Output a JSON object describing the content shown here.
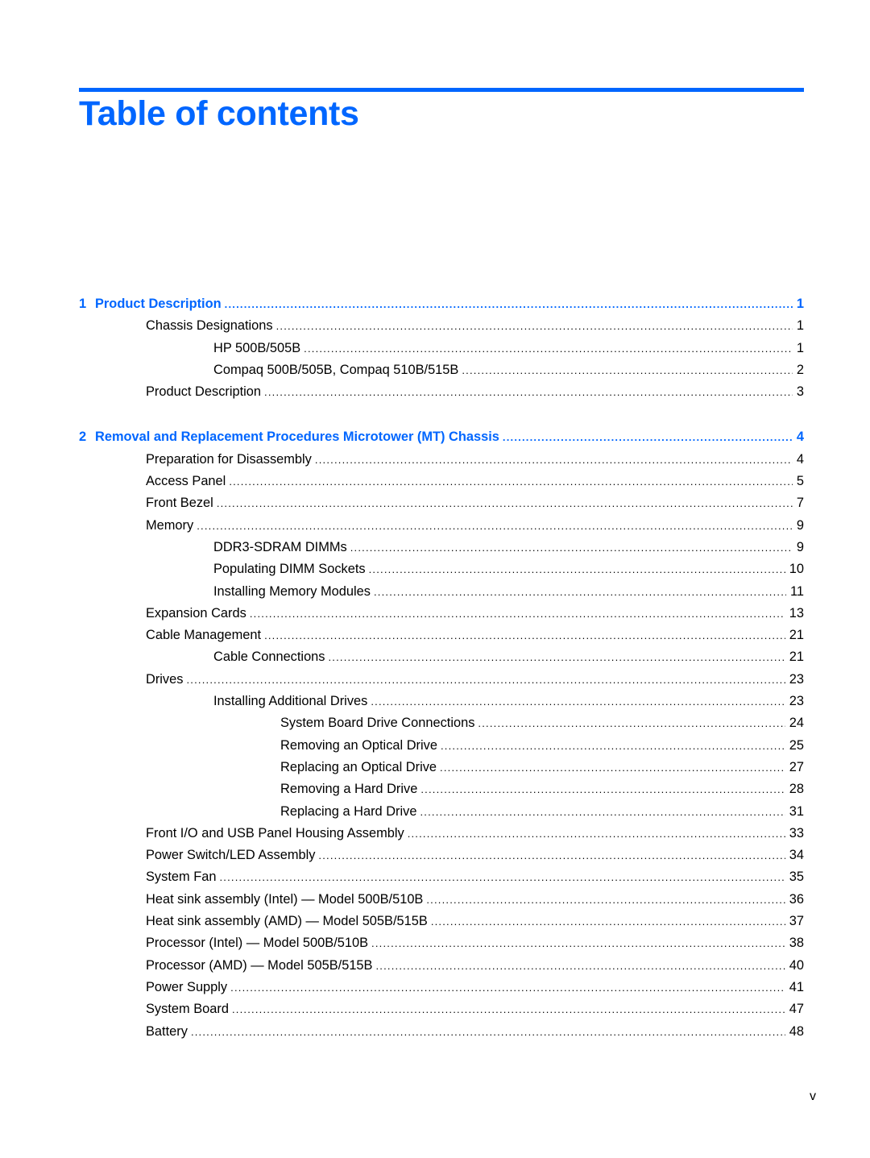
{
  "title": "Table of contents",
  "colors": {
    "accent": "#0066ff",
    "text": "#000000"
  },
  "chapters": [
    {
      "number": "1",
      "title": "Product Description",
      "page": "1",
      "entries": [
        {
          "level": 1,
          "title": "Chassis Designations",
          "page": "1"
        },
        {
          "level": 2,
          "title": "HP 500B/505B",
          "page": "1"
        },
        {
          "level": 2,
          "title": "Compaq 500B/505B, Compaq 510B/515B",
          "page": "2"
        },
        {
          "level": 1,
          "title": "Product Description",
          "page": "3"
        }
      ]
    },
    {
      "number": "2",
      "title": "Removal and Replacement Procedures Microtower (MT) Chassis",
      "page": "4",
      "entries": [
        {
          "level": 1,
          "title": "Preparation for Disassembly",
          "page": "4"
        },
        {
          "level": 1,
          "title": "Access Panel",
          "page": "5"
        },
        {
          "level": 1,
          "title": "Front Bezel",
          "page": "7"
        },
        {
          "level": 1,
          "title": "Memory",
          "page": "9"
        },
        {
          "level": 2,
          "title": "DDR3-SDRAM DIMMs",
          "page": "9"
        },
        {
          "level": 2,
          "title": "Populating DIMM Sockets",
          "page": "10"
        },
        {
          "level": 2,
          "title": "Installing Memory Modules",
          "page": "11"
        },
        {
          "level": 1,
          "title": "Expansion Cards",
          "page": "13"
        },
        {
          "level": 1,
          "title": "Cable Management",
          "page": "21"
        },
        {
          "level": 2,
          "title": "Cable Connections",
          "page": "21"
        },
        {
          "level": 1,
          "title": "Drives",
          "page": "23"
        },
        {
          "level": 2,
          "title": "Installing Additional Drives",
          "page": "23"
        },
        {
          "level": 3,
          "title": "System Board Drive Connections",
          "page": "24"
        },
        {
          "level": 3,
          "title": "Removing an Optical Drive",
          "page": "25"
        },
        {
          "level": 3,
          "title": "Replacing an Optical Drive",
          "page": "27"
        },
        {
          "level": 3,
          "title": "Removing a Hard Drive",
          "page": "28"
        },
        {
          "level": 3,
          "title": "Replacing a Hard Drive",
          "page": "31"
        },
        {
          "level": 1,
          "title": "Front I/O and USB Panel Housing Assembly",
          "page": "33"
        },
        {
          "level": 1,
          "title": "Power Switch/LED Assembly",
          "page": "34"
        },
        {
          "level": 1,
          "title": "System Fan",
          "page": "35"
        },
        {
          "level": 1,
          "title": "Heat sink assembly (Intel) — Model 500B/510B",
          "page": "36"
        },
        {
          "level": 1,
          "title": "Heat sink assembly (AMD) — Model 505B/515B",
          "page": "37"
        },
        {
          "level": 1,
          "title": "Processor (Intel) — Model 500B/510B",
          "page": "38"
        },
        {
          "level": 1,
          "title": "Processor (AMD) — Model 505B/515B",
          "page": "40"
        },
        {
          "level": 1,
          "title": "Power Supply",
          "page": "41"
        },
        {
          "level": 1,
          "title": "System Board",
          "page": "47"
        },
        {
          "level": 1,
          "title": "Battery",
          "page": "48"
        }
      ]
    }
  ],
  "footer": {
    "page_number": "v"
  }
}
